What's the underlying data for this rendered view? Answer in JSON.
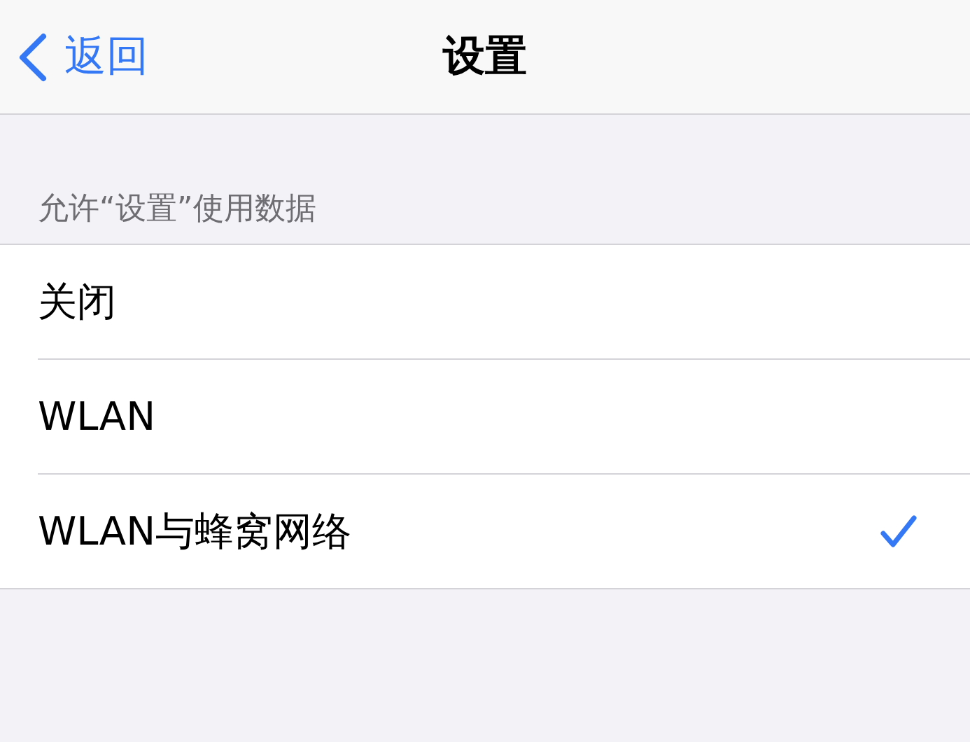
{
  "nav_bar": {
    "back_label": "返回",
    "title": "设置"
  },
  "section": {
    "header": "允许“设置”使用数据",
    "options": [
      {
        "label": "关闭",
        "selected": false
      },
      {
        "label": "WLAN",
        "selected": false
      },
      {
        "label": "WLAN与蜂窝网络",
        "selected": true
      }
    ]
  }
}
